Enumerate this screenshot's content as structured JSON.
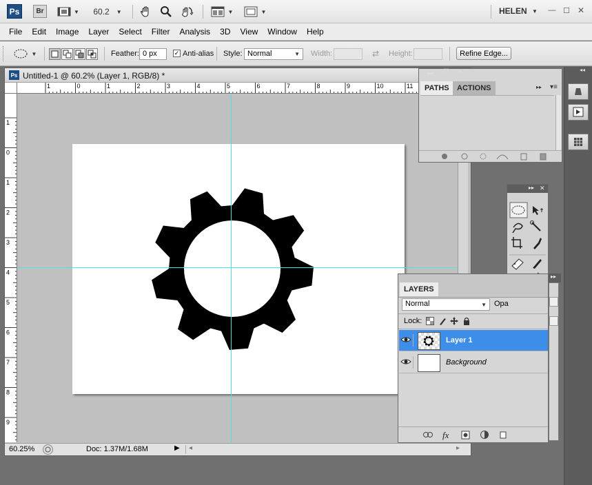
{
  "appbar": {
    "ps_logo": "Ps",
    "br_logo": "Br",
    "zoom": "60.2",
    "user": "HELEN",
    "icons": [
      "film-strip-icon",
      "hand-icon",
      "zoom-icon",
      "rotate-view-icon",
      "arrange-documents-icon",
      "screen-mode-icon"
    ]
  },
  "window": {
    "minimize": "—",
    "maximize": "☐",
    "close": "✕"
  },
  "menu": [
    "File",
    "Edit",
    "Image",
    "Layer",
    "Select",
    "Filter",
    "Analysis",
    "3D",
    "View",
    "Window",
    "Help"
  ],
  "options": {
    "feather_label": "Feather:",
    "feather_value": "0 px",
    "antialias_label": "Anti-alias",
    "antialias_checked": true,
    "style_label": "Style:",
    "style_value": "Normal",
    "width_label": "Width:",
    "height_label": "Height:",
    "refine_edge": "Refine Edge..."
  },
  "document": {
    "title": "Untitled-1 @ 60.2% (Layer 1, RGB/8) *",
    "ruler_top_labels": [
      "1",
      "0",
      "1",
      "2",
      "3",
      "4",
      "5",
      "6",
      "7",
      "8",
      "9",
      "10",
      "11"
    ],
    "ruler_left_labels": [
      "1",
      "0",
      "1",
      "2",
      "3",
      "4",
      "5",
      "6",
      "7",
      "8",
      "9"
    ],
    "status_zoom": "60.25%",
    "status_doc": "Doc: 1.37M/1.68M"
  },
  "paths_panel": {
    "tabs": [
      "PATHS",
      "ACTIONS"
    ],
    "active_tab": "PATHS",
    "menu_glyph": "▸▸"
  },
  "tools_panel": {
    "expand_glyph": "▸▸",
    "close_glyph": "✕"
  },
  "layers_panel": {
    "tab": "LAYERS",
    "blend_mode": "Normal",
    "opacity_label": "Opa",
    "lock_label": "Lock:",
    "layers": [
      {
        "name": "Layer 1",
        "selected": true,
        "visible": true
      },
      {
        "name": "Background",
        "selected": false,
        "visible": true
      }
    ]
  },
  "colors": {
    "guide": "#4fe0e0",
    "selected_layer": "#3d8ee8",
    "foreground": "#ffffff",
    "background": "#000000"
  }
}
